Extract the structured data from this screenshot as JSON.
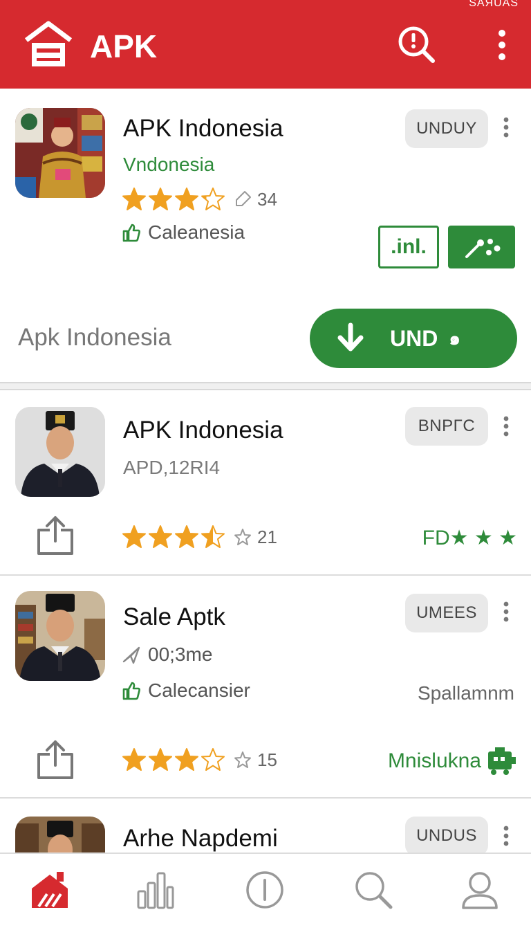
{
  "appbar": {
    "title": "APK",
    "status_text": "SAЯUAS",
    "icons": [
      "home-logo-icon",
      "search-alert-icon",
      "more-vert-icon"
    ],
    "color": "#d62a2f"
  },
  "cards": [
    {
      "name": "APK Indonesia",
      "subtitle": "Vndonesia",
      "pill": "UNDUY",
      "rating": 3.2,
      "count": "34",
      "meta_label": "Caleanesia",
      "chip_text": ".inl.",
      "footer_label": "Apk Indonesia",
      "download_label": "UND",
      "download_tail": "๑"
    },
    {
      "name": "APK Indonesia",
      "subtitle": "APD,12RI4",
      "pill": "BNPΓC",
      "rating": 3.5,
      "count": "21",
      "right_label": "FD★ ★ ★"
    },
    {
      "name": "Sale Aptk",
      "subtitle": "00;3me",
      "pill": "UMEES",
      "meta_label": "Calecansier",
      "right_meta": "Spallamnm",
      "rating": 3,
      "count": "15",
      "right_label": "Mnislukna"
    },
    {
      "name": "Arhe Napdemi",
      "pill": "UNDUS"
    }
  ],
  "bottom_nav": [
    "home-icon",
    "chart-icon",
    "info-icon",
    "search-icon",
    "profile-icon"
  ],
  "colors": {
    "accent": "#d62a2f",
    "green": "#2e8b3a",
    "star": "#f0a020"
  }
}
